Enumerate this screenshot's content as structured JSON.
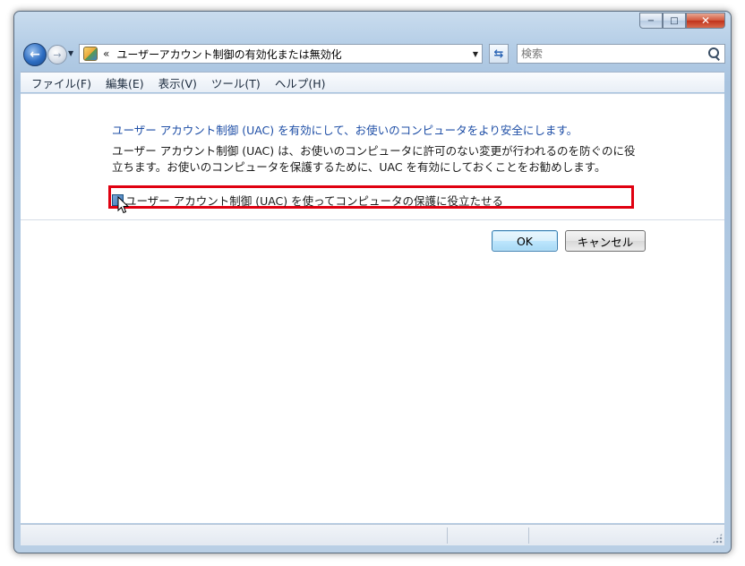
{
  "window": {
    "caption": {
      "minimize": "−",
      "maximize": "□",
      "close": "✕"
    }
  },
  "navbar": {
    "back_glyph": "←",
    "forward_glyph": "→",
    "dropdown_glyph": "▼",
    "address": {
      "icon": "user-accounts-icon",
      "chevron": "«",
      "path": "ユーザーアカウント制御の有効化または無効化",
      "dropdown_glyph": "▼"
    },
    "refresh_glyph": "⇆",
    "search": {
      "placeholder": "検索"
    }
  },
  "menubar": {
    "items": [
      {
        "label": "ファイル(F)"
      },
      {
        "label": "編集(E)"
      },
      {
        "label": "表示(V)"
      },
      {
        "label": "ツール(T)"
      },
      {
        "label": "ヘルプ(H)"
      }
    ]
  },
  "main": {
    "heading": "ユーザー アカウント制御 (UAC) を有効にして、お使いのコンピュータをより安全にします。",
    "description": "ユーザー アカウント制御 (UAC) は、お使いのコンピュータに許可のない変更が行われるのを防ぐのに役立ちます。お使いのコンピュータを保護するために、UAC を有効にしておくことをお勧めします。",
    "checkbox": {
      "label": "ユーザー アカウント制御 (UAC) を使ってコンピュータの保護に役立たせる",
      "checked": true
    },
    "buttons": {
      "ok": "OK",
      "cancel": "キャンセル"
    }
  },
  "colors": {
    "heading": "#1e4ea6",
    "highlight_border": "#e00010",
    "close_button": "#c0321b"
  }
}
